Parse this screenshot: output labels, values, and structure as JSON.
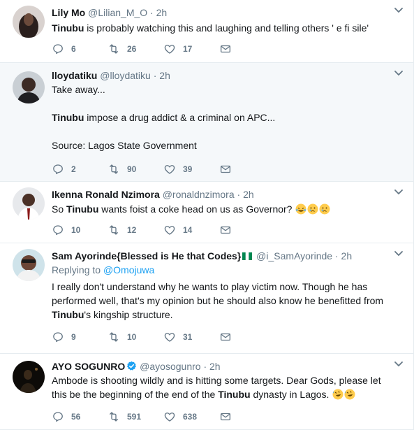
{
  "tweets": [
    {
      "name": "Lily Mo",
      "handle": "@Lilian_M_O",
      "time": "2h",
      "text": "Tinubu is probably watching this and laughing and telling others ' e fi sile'",
      "replies": "6",
      "retweets": "26",
      "likes": "17"
    },
    {
      "name": "lloydatiku",
      "handle": "@lloydatiku",
      "time": "2h",
      "line1": "Take away...",
      "line2": "Tinubu impose a drug addict & a criminal on APC...",
      "line3": "Source: Lagos State Government",
      "replies": "2",
      "retweets": "90",
      "likes": "39"
    },
    {
      "name": "Ikenna Ronald Nzimora",
      "handle": "@ronaldnzimora",
      "time": "2h",
      "text": "So Tinubu wants foist a coke head on us as Governor?",
      "replies": "10",
      "retweets": "12",
      "likes": "14"
    },
    {
      "name": "Sam Ayorinde{Blessed is He that Codes}",
      "handle": "@i_SamAyorinde",
      "time": "2h",
      "replying_label": "Replying to",
      "replying_to": "@Omojuwa",
      "text": "I really don't understand why he wants to play victim now. Though he has performed well, that's my opinion but he should also know he benefitted from Tinubu's kingship structure.",
      "replies": "9",
      "retweets": "10",
      "likes": "31"
    },
    {
      "name": "AYO SOGUNRO",
      "handle": "@ayosogunro",
      "time": "2h",
      "text": "Ambode is shooting wildly and is hitting some targets. Dear Gods, please let this be the beginning of the end of the Tinubu dynasty in Lagos.",
      "replies": "56",
      "retweets": "591",
      "likes": "638"
    }
  ],
  "separator": "·",
  "colors": {
    "accent": "#1da1f2",
    "muted": "#657786",
    "border": "#e6ecf0"
  }
}
